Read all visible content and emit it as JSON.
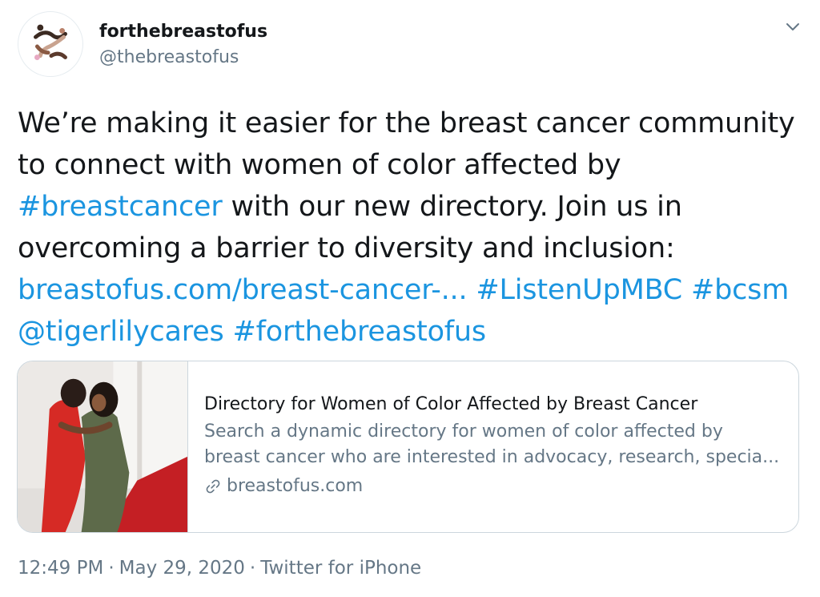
{
  "user": {
    "display_name": "forthebreastofus",
    "handle": "@thebreastofus"
  },
  "tweet": {
    "line1": "We’re making it easier for the breast cancer community",
    "line2": "to connect with women of color affected by",
    "hashtag_breastcancer": "#breastcancer",
    "line3_rest": " with our new directory. Join us in",
    "line4": "overcoming a barrier to diversity and inclusion:",
    "link_url": "breastofus.com/breast-cancer-...",
    "hashtag_listenup": "#ListenUpMBC",
    "hashtag_bcsm": "#bcsm",
    "mention": "@tigerlilycares",
    "hashtag_forthebreastofus": "#forthebreastofus"
  },
  "card": {
    "title": "Directory for Women of Color Affected by Breast Cancer",
    "desc_line1": "Search a dynamic directory for women of color affected by",
    "desc_line2": "breast cancer who are interested in advocacy, research, specia...",
    "domain": "breastofus.com"
  },
  "meta": {
    "time": "12:49 PM",
    "date": "May 29, 2020",
    "source": "Twitter for iPhone",
    "separator": "·"
  },
  "icons": {
    "caret": "chevron-down-icon",
    "link": "link-icon"
  },
  "colors": {
    "link": "#1b95e0",
    "text": "#14171a",
    "muted": "#657786",
    "border": "#ccd6dd"
  }
}
